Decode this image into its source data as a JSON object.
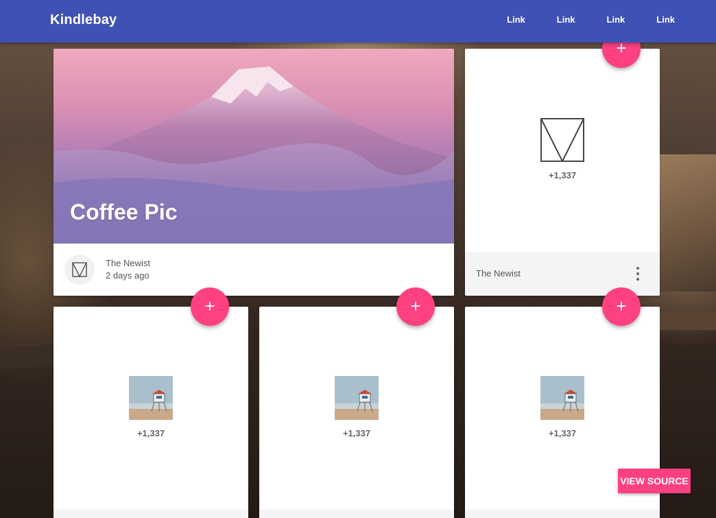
{
  "header": {
    "brand": "Kindlebay",
    "links": [
      "Link",
      "Link",
      "Link",
      "Link"
    ]
  },
  "hero_card": {
    "title": "Coffee Pic",
    "author": "The Newist",
    "time": "2 days ago"
  },
  "tall_card": {
    "count": "+1,337",
    "footer_label": "The Newist"
  },
  "small_cards": [
    {
      "count": "+1,337"
    },
    {
      "count": "+1,337"
    },
    {
      "count": "+1,337"
    }
  ],
  "fab_symbol": "+",
  "view_source_label": "VIEW SOURCE",
  "colors": {
    "appbar": "#3f51b5",
    "accent": "#ff4081"
  }
}
